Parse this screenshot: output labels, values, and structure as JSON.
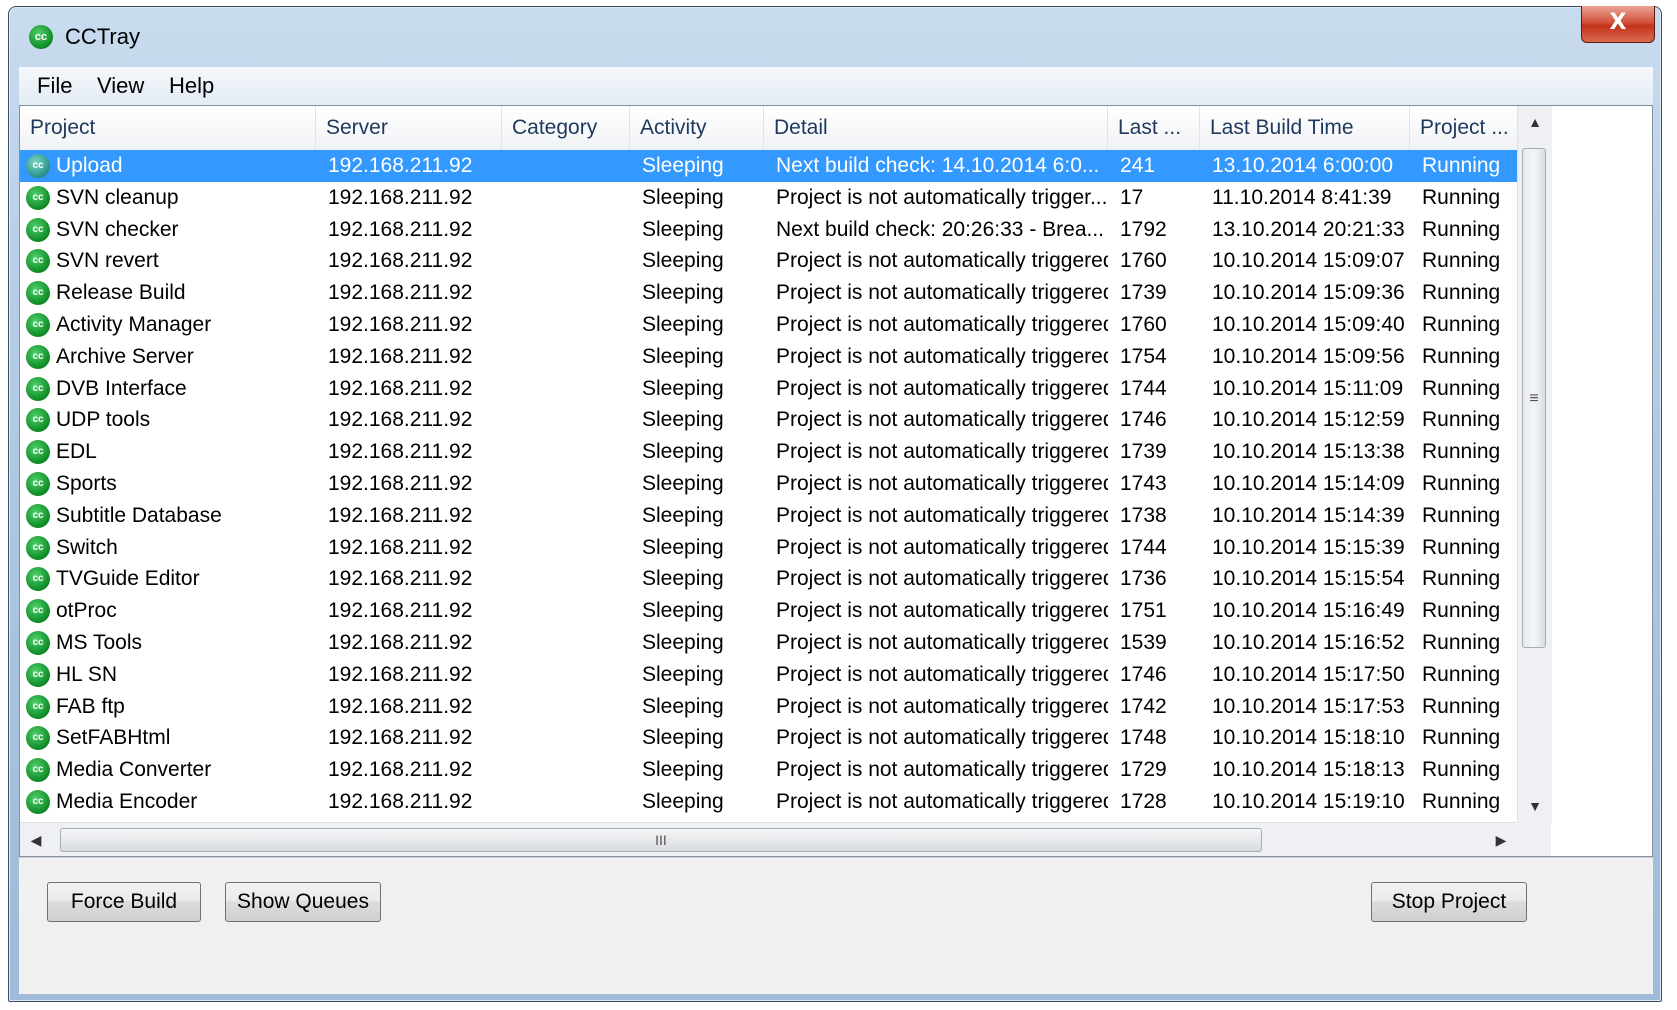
{
  "window": {
    "title": "CCTray",
    "app_icon_glyph": "cc",
    "close_glyph": "X"
  },
  "menu": [
    {
      "label": "File"
    },
    {
      "label": "View"
    },
    {
      "label": "Help"
    }
  ],
  "columns": [
    "Project",
    "Server",
    "Category",
    "Activity",
    "Detail",
    "Last ...",
    "Last Build Time",
    "Project ..."
  ],
  "rows": [
    {
      "project": "Upload",
      "server": "192.168.211.92",
      "category": "",
      "activity": "Sleeping",
      "detail": "Next build check: 14.10.2014 6:0...",
      "last": "241",
      "last_build_time": "13.10.2014 6:00:00",
      "status": "Running",
      "selected": true
    },
    {
      "project": "SVN cleanup",
      "server": "192.168.211.92",
      "category": "",
      "activity": "Sleeping",
      "detail": "Project is not automatically trigger...",
      "last": "17",
      "last_build_time": "11.10.2014 8:41:39",
      "status": "Running"
    },
    {
      "project": "SVN checker",
      "server": "192.168.211.92",
      "category": "",
      "activity": "Sleeping",
      "detail": "Next build check: 20:26:33 - Brea...",
      "last": "1792",
      "last_build_time": "13.10.2014 20:21:33",
      "status": "Running"
    },
    {
      "project": "SVN revert",
      "server": "192.168.211.92",
      "category": "",
      "activity": "Sleeping",
      "detail": "Project is not automatically triggered",
      "last": "1760",
      "last_build_time": "10.10.2014 15:09:07",
      "status": "Running"
    },
    {
      "project": "Release Build",
      "server": "192.168.211.92",
      "category": "",
      "activity": "Sleeping",
      "detail": "Project is not automatically triggered",
      "last": "1739",
      "last_build_time": "10.10.2014 15:09:36",
      "status": "Running"
    },
    {
      "project": "Activity Manager",
      "server": "192.168.211.92",
      "category": "",
      "activity": "Sleeping",
      "detail": "Project is not automatically triggered",
      "last": "1760",
      "last_build_time": "10.10.2014 15:09:40",
      "status": "Running"
    },
    {
      "project": "Archive Server",
      "server": "192.168.211.92",
      "category": "",
      "activity": "Sleeping",
      "detail": "Project is not automatically triggered",
      "last": "1754",
      "last_build_time": "10.10.2014 15:09:56",
      "status": "Running"
    },
    {
      "project": "DVB Interface",
      "server": "192.168.211.92",
      "category": "",
      "activity": "Sleeping",
      "detail": "Project is not automatically triggered",
      "last": "1744",
      "last_build_time": "10.10.2014 15:11:09",
      "status": "Running"
    },
    {
      "project": "UDP tools",
      "server": "192.168.211.92",
      "category": "",
      "activity": "Sleeping",
      "detail": "Project is not automatically triggered",
      "last": "1746",
      "last_build_time": "10.10.2014 15:12:59",
      "status": "Running"
    },
    {
      "project": "EDL",
      "server": "192.168.211.92",
      "category": "",
      "activity": "Sleeping",
      "detail": "Project is not automatically triggered",
      "last": "1739",
      "last_build_time": "10.10.2014 15:13:38",
      "status": "Running"
    },
    {
      "project": "Sports",
      "server": "192.168.211.92",
      "category": "",
      "activity": "Sleeping",
      "detail": "Project is not automatically triggered",
      "last": "1743",
      "last_build_time": "10.10.2014 15:14:09",
      "status": "Running"
    },
    {
      "project": "Subtitle Database",
      "server": "192.168.211.92",
      "category": "",
      "activity": "Sleeping",
      "detail": "Project is not automatically triggered",
      "last": "1738",
      "last_build_time": "10.10.2014 15:14:39",
      "status": "Running"
    },
    {
      "project": "Switch",
      "server": "192.168.211.92",
      "category": "",
      "activity": "Sleeping",
      "detail": "Project is not automatically triggered",
      "last": "1744",
      "last_build_time": "10.10.2014 15:15:39",
      "status": "Running"
    },
    {
      "project": "TVGuide Editor",
      "server": "192.168.211.92",
      "category": "",
      "activity": "Sleeping",
      "detail": "Project is not automatically triggered",
      "last": "1736",
      "last_build_time": "10.10.2014 15:15:54",
      "status": "Running"
    },
    {
      "project": "otProc",
      "server": "192.168.211.92",
      "category": "",
      "activity": "Sleeping",
      "detail": "Project is not automatically triggered",
      "last": "1751",
      "last_build_time": "10.10.2014 15:16:49",
      "status": "Running"
    },
    {
      "project": "MS Tools",
      "server": "192.168.211.92",
      "category": "",
      "activity": "Sleeping",
      "detail": "Project is not automatically triggered",
      "last": "1539",
      "last_build_time": "10.10.2014 15:16:52",
      "status": "Running"
    },
    {
      "project": "HL SN",
      "server": "192.168.211.92",
      "category": "",
      "activity": "Sleeping",
      "detail": "Project is not automatically triggered",
      "last": "1746",
      "last_build_time": "10.10.2014 15:17:50",
      "status": "Running"
    },
    {
      "project": "FAB ftp",
      "server": "192.168.211.92",
      "category": "",
      "activity": "Sleeping",
      "detail": "Project is not automatically triggered",
      "last": "1742",
      "last_build_time": "10.10.2014 15:17:53",
      "status": "Running"
    },
    {
      "project": "SetFABHtml",
      "server": "192.168.211.92",
      "category": "",
      "activity": "Sleeping",
      "detail": "Project is not automatically triggered",
      "last": "1748",
      "last_build_time": "10.10.2014 15:18:10",
      "status": "Running"
    },
    {
      "project": "Media Converter",
      "server": "192.168.211.92",
      "category": "",
      "activity": "Sleeping",
      "detail": "Project is not automatically triggered",
      "last": "1729",
      "last_build_time": "10.10.2014 15:18:13",
      "status": "Running"
    },
    {
      "project": "Media Encoder",
      "server": "192.168.211.92",
      "category": "",
      "activity": "Sleeping",
      "detail": "Project is not automatically triggered",
      "last": "1728",
      "last_build_time": "10.10.2014 15:19:10",
      "status": "Running"
    }
  ],
  "scrollbars": {
    "vertical_grip": "≡",
    "horizontal_grip": "III"
  },
  "buttons": {
    "force_build": "Force Build",
    "show_queues": "Show Queues",
    "stop_project": "Stop Project"
  },
  "colors": {
    "selection": "#3399ff",
    "project_icon": "#0d8a25",
    "close_button": "#c4331b"
  }
}
